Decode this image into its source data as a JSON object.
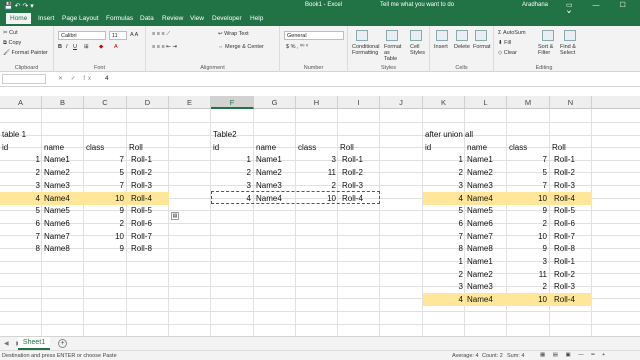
{
  "app": {
    "title": "Book1 - Excel",
    "tell": "Tell me what you want to do",
    "user": "Aradhana"
  },
  "tabs": [
    "Home",
    "Insert",
    "Page Layout",
    "Formulas",
    "Data",
    "Review",
    "View",
    "Developer",
    "Help"
  ],
  "ribbon": {
    "clipboard": {
      "cut": "Cut",
      "copy": "Copy",
      "painter": "Format Painter",
      "label": "Clipboard"
    },
    "font": {
      "name": "Calibri",
      "size": "11",
      "label": "Font"
    },
    "alignment": {
      "wrap": "Wrap Text",
      "merge": "Merge & Center",
      "label": "Alignment"
    },
    "number": {
      "format": "General",
      "label": "Number"
    },
    "styles": {
      "cond": "Conditional Formatting",
      "table": "Format as Table",
      "cell": "Cell Styles",
      "label": "Styles"
    },
    "cells": {
      "insert": "Insert",
      "delete": "Delete",
      "format": "Format",
      "label": "Cells"
    },
    "editing": {
      "autosum": "AutoSum",
      "fill": "Fill",
      "clear": "Clear",
      "sort": "Sort & Filter",
      "find": "Find & Select",
      "label": "Editing"
    }
  },
  "formula_bar": {
    "value": "4"
  },
  "columns": [
    "A",
    "B",
    "C",
    "D",
    "E",
    "F",
    "G",
    "H",
    "I",
    "J",
    "K",
    "L",
    "M",
    "N"
  ],
  "selected_column": "F",
  "cells": {
    "t1": {
      "title": "table 1",
      "headers": [
        "id",
        "name",
        "class",
        "Roll"
      ],
      "rows": [
        [
          "1",
          "Name1",
          "7",
          "Roll-1"
        ],
        [
          "2",
          "Name2",
          "5",
          "Roll-2"
        ],
        [
          "3",
          "Name3",
          "7",
          "Roll-3"
        ],
        [
          "4",
          "Name4",
          "10",
          "Roll-4"
        ],
        [
          "5",
          "Name5",
          "9",
          "Roll-5"
        ],
        [
          "6",
          "Name6",
          "2",
          "Roll-6"
        ],
        [
          "7",
          "Name7",
          "10",
          "Roll-7"
        ],
        [
          "8",
          "Name8",
          "9",
          "Roll-8"
        ]
      ]
    },
    "t2": {
      "title": "Table2",
      "headers": [
        "id",
        "name",
        "class",
        "Roll"
      ],
      "rows": [
        [
          "1",
          "Name1",
          "3",
          "Roll-1"
        ],
        [
          "2",
          "Name2",
          "11",
          "Roll-2"
        ],
        [
          "3",
          "Name3",
          "2",
          "Roll-3"
        ],
        [
          "4",
          "Name4",
          "10",
          "Roll-4"
        ]
      ]
    },
    "t3": {
      "title": "after union all",
      "headers": [
        "id",
        "name",
        "class",
        "Roll"
      ],
      "rows": [
        [
          "1",
          "Name1",
          "7",
          "Roll-1"
        ],
        [
          "2",
          "Name2",
          "5",
          "Roll-2"
        ],
        [
          "3",
          "Name3",
          "7",
          "Roll-3"
        ],
        [
          "4",
          "Name4",
          "10",
          "Roll-4"
        ],
        [
          "5",
          "Name5",
          "9",
          "Roll-5"
        ],
        [
          "6",
          "Name6",
          "2",
          "Roll-6"
        ],
        [
          "7",
          "Name7",
          "10",
          "Roll-7"
        ],
        [
          "8",
          "Name8",
          "9",
          "Roll-8"
        ],
        [
          "1",
          "Name1",
          "3",
          "Roll-1"
        ],
        [
          "2",
          "Name2",
          "11",
          "Roll-2"
        ],
        [
          "3",
          "Name3",
          "2",
          "Roll-3"
        ],
        [
          "4",
          "Name4",
          "10",
          "Roll-4"
        ]
      ]
    }
  },
  "highlight_color": "#ffe699",
  "sheet": {
    "name": "Sheet1"
  },
  "status": {
    "message": "Destination and press ENTER or choose Paste",
    "average": "Average: 4",
    "count": "Count: 2",
    "sum": "Sum: 4"
  }
}
